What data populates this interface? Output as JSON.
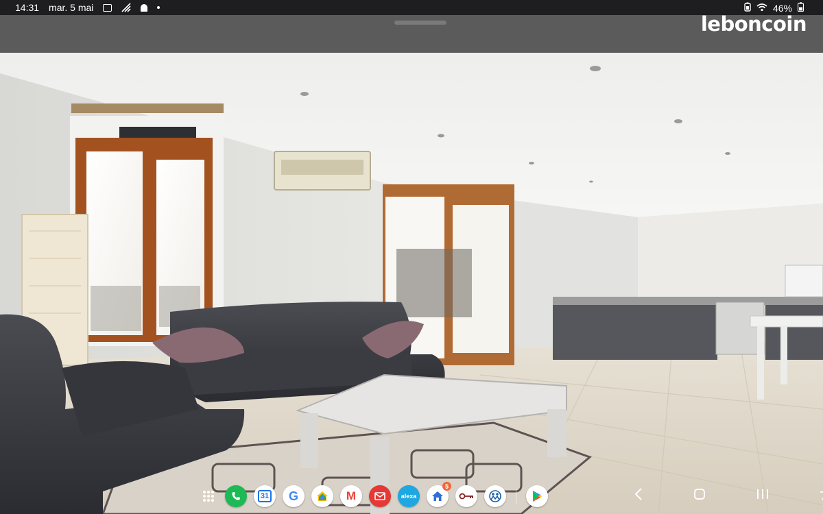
{
  "status_bar": {
    "time": "14:31",
    "date": "mar. 5 mai",
    "battery": "46%"
  },
  "app": {
    "brand": "leboncoin"
  },
  "dock": {
    "apps": [
      {
        "name": "phone",
        "label": "",
        "color": "#1db954"
      },
      {
        "name": "calendar",
        "label": "31",
        "color": "#ffffff"
      },
      {
        "name": "google",
        "label": "G",
        "color": "#ffffff"
      },
      {
        "name": "google-home",
        "label": "",
        "color": "#ffffff"
      },
      {
        "name": "gmail",
        "label": "M",
        "color": "#ffffff"
      },
      {
        "name": "mail",
        "label": "",
        "color": "#e53935"
      },
      {
        "name": "alexa",
        "label": "alexa",
        "color": "#1ea7e1"
      },
      {
        "name": "home-app",
        "label": "",
        "color": "#ffffff",
        "badge": "5"
      },
      {
        "name": "key-app",
        "label": "",
        "color": "#ffffff"
      },
      {
        "name": "people-app",
        "label": "",
        "color": "#ffffff"
      },
      {
        "name": "play-store",
        "label": "",
        "color": "#ffffff"
      }
    ]
  },
  "colors": {
    "status_bg": "#1e1e20",
    "header_bg": "#5b5b5b"
  }
}
